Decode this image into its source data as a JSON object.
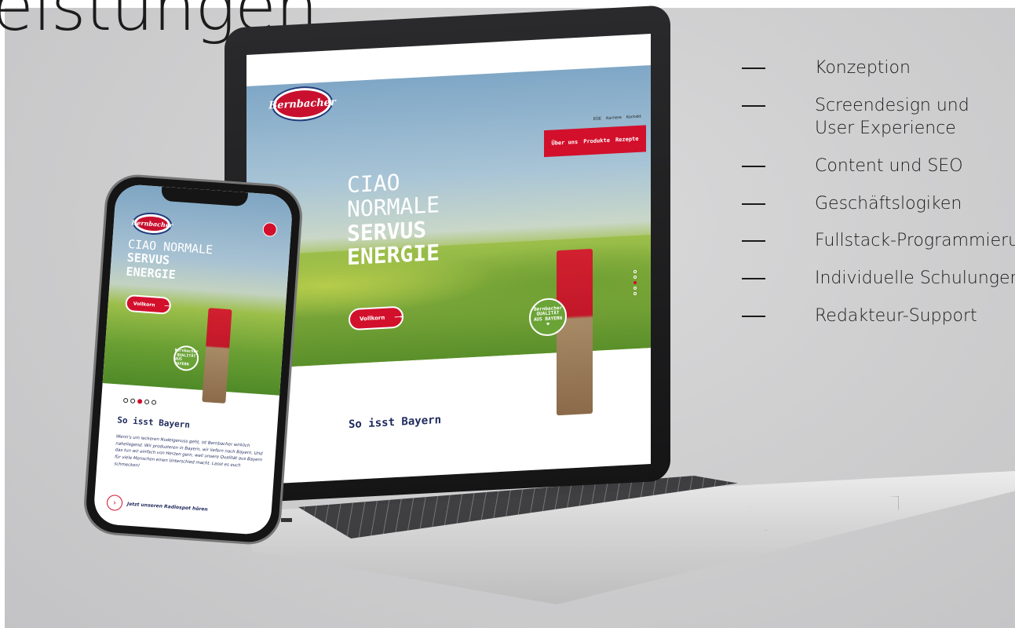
{
  "heading": "eistungen",
  "services": [
    {
      "label": "Konzeption"
    },
    {
      "label": "Screendesign und\nUser Experience"
    },
    {
      "label": "Content und SEO"
    },
    {
      "label": "Geschäftslogiken"
    },
    {
      "label": "Fullstack-Programmierung"
    },
    {
      "label": "Individuelle Schulungen"
    },
    {
      "label": "Redakteur-Support"
    }
  ],
  "laptop": {
    "logo": "Bernbacher",
    "nav_top": [
      "EGE",
      "Karriere",
      "Kontakt"
    ],
    "nav": [
      "Über uns",
      "Produkte",
      "Rezepte"
    ],
    "hero_line1": "CIAO",
    "hero_line2": "NORMALE",
    "hero_line3": "SERVUS",
    "hero_line4": "ENERGIE",
    "button": "Vollkorn",
    "badge_brand": "Bernbacher",
    "badge_line1": "QUALITÄT",
    "badge_line2": "AUS BAYERN",
    "subheading": "So isst Bayern"
  },
  "phone": {
    "logo": "Bernbacher",
    "hero_line1": "CIAO NORMALE",
    "hero_line2": "SERVUS",
    "hero_line3": "ENERGIE",
    "button": "Vollkorn",
    "badge_brand": "Bernbacher",
    "badge_line1": "QUALITÄT",
    "badge_line2": "AUS BAYERN",
    "subheading": "So isst Bayern",
    "body": "Wenn's um leckeren Nudelgenuss geht, ist Bernbacher wirklich naheliegend. Wir produzieren in Bayern, wir liefern nach Bayern. Und das tun wir einfach von Herzen gern, weil unsere Qualität aus Bayern für viele Menschen einen Unterschied macht. Lasst es euch schmecken!",
    "audio_link": "Jetzt unseren Radiospot hören"
  },
  "colors": {
    "brand_red": "#d2102c",
    "brand_navy": "#1f2a5c",
    "badge_green": "#6aa336"
  }
}
